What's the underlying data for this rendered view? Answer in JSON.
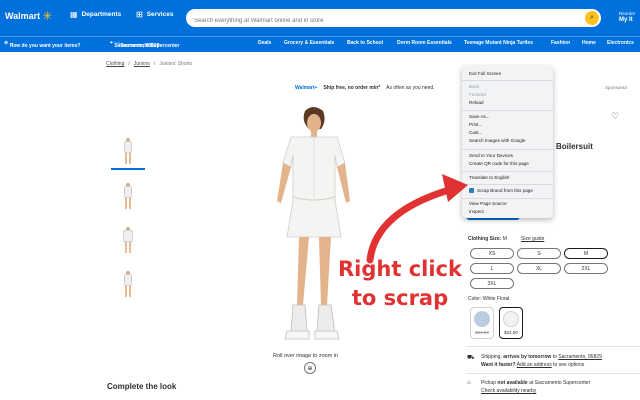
{
  "header": {
    "logo_text": "Walmart",
    "departments": "Departments",
    "services": "Services",
    "search_placeholder": "Search everything at Walmart online and in store",
    "reorder_label": "Reorder",
    "account_label": "My It"
  },
  "subnav": {
    "delivery_prompt": "How do you want your items?",
    "location": "Sacramento, 95829",
    "store": "Sacramento Supercenter",
    "links": [
      "Deals",
      "Grocery & Essentials",
      "Back to School",
      "Dorm Room Essentials",
      "Teenage Mutant Ninja Turtles",
      "Fashion",
      "Home",
      "Electronics"
    ]
  },
  "breadcrumb": [
    "Clothing",
    "Juniors",
    "Juniors' Shorts"
  ],
  "banner": {
    "brand": "Walmart+",
    "ship_text": "Ship free, no order min*",
    "tail": "As often as you need.",
    "sponsored": "Sponsored"
  },
  "product": {
    "title_fragment": "Boilersuit",
    "zoom_hint": "Roll over image to zoom in",
    "complete_the_look": "Complete the look"
  },
  "sizes": {
    "label": "Clothing Size:",
    "selected": "M",
    "guide": "Size guide",
    "options": [
      "XS",
      "S",
      "M",
      "L",
      "XL",
      "2XL",
      "3XL"
    ]
  },
  "color": {
    "label": "Color:",
    "value": "White Floral",
    "swatches": [
      {
        "price": "$24.50",
        "hex": "#b9cde0",
        "struck": true
      },
      {
        "price": "$24.50",
        "hex": "#f2f2f2",
        "struck": false
      }
    ]
  },
  "fulfillment": {
    "shipping_prefix": "Shipping,",
    "shipping_when": "arrives by tomorrow",
    "shipping_to": "to",
    "shipping_city": "Sacramento, 95829",
    "want_faster": "Want it faster?",
    "add_address": "Add an address",
    "see_options": "to see options",
    "pickup_prefix": "Pickup",
    "pickup_status": "not available",
    "pickup_at": "at Sacramento Supercenter",
    "check_nearby": "Check availability nearby"
  },
  "context_menu": {
    "items": [
      {
        "label": "Exit Full Screen",
        "disabled": false
      },
      {
        "label": "Back",
        "disabled": true
      },
      {
        "label": "Forward",
        "disabled": true
      },
      {
        "label": "Reload",
        "disabled": false
      },
      {
        "label": "Save As...",
        "disabled": false
      },
      {
        "label": "Print...",
        "disabled": false
      },
      {
        "label": "Cast...",
        "disabled": false
      },
      {
        "label": "Search Images with Google",
        "disabled": false
      },
      {
        "label": "Send to Your Devices",
        "disabled": false
      },
      {
        "label": "Create QR code for this page",
        "disabled": false
      },
      {
        "label": "Translate to English",
        "disabled": false
      },
      {
        "label": "Scrap Brand from this page",
        "disabled": false
      },
      {
        "label": "View Page Source",
        "disabled": false
      },
      {
        "label": "Inspect",
        "disabled": false
      }
    ]
  },
  "annotation": {
    "line1": "Right click",
    "line2": "to scrap",
    "color": "#e03232"
  },
  "colors": {
    "brand_blue": "#0071dc",
    "brand_yellow": "#ffc220"
  }
}
